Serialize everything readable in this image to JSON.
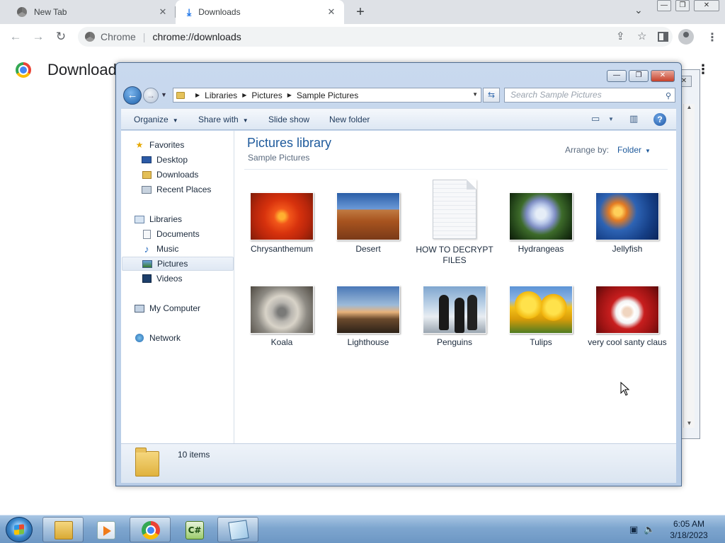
{
  "browser": {
    "tabs": [
      {
        "label": "New Tab",
        "close": "✕"
      },
      {
        "label": "Downloads",
        "close": "✕"
      }
    ],
    "new_tab": "+",
    "tab_search": "⌄",
    "window_controls": {
      "minimize": "—",
      "restore": "❐",
      "close": "✕"
    },
    "omnibox": {
      "site": "Chrome",
      "separator": "|",
      "url": "chrome://downloads"
    },
    "page_title": "Download",
    "icons": [
      "back-icon",
      "forward-icon",
      "reload-icon",
      "share-icon",
      "star-icon",
      "side-panel-icon",
      "profile-icon",
      "kebab-menu-icon"
    ]
  },
  "explorer": {
    "window_controls": {
      "minimize": "—",
      "maximize": "❐",
      "close": "✕"
    },
    "breadcrumb": [
      "Libraries",
      "Sample Pictures"
    ],
    "breadcrumb_mid": "Pictures",
    "search_placeholder": "Search Sample Pictures",
    "commands": {
      "organize": "Organize",
      "share": "Share with",
      "slideshow": "Slide show",
      "new_folder": "New folder"
    },
    "nav": {
      "favorites": "Favorites",
      "desktop": "Desktop",
      "downloads": "Downloads",
      "recent": "Recent Places",
      "libraries": "Libraries",
      "documents": "Documents",
      "music": "Music",
      "pictures": "Pictures",
      "videos": "Videos",
      "computer": "My Computer",
      "network": "Network"
    },
    "library_title": "Pictures library",
    "library_subtitle": "Sample Pictures",
    "arrange_label": "Arrange by:",
    "arrange_value": "Folder",
    "files": [
      {
        "name": "Chrysanthemum"
      },
      {
        "name": "Desert"
      },
      {
        "name": "HOW TO DECRYPT FILES"
      },
      {
        "name": "Hydrangeas"
      },
      {
        "name": "Jellyfish"
      },
      {
        "name": "Koala"
      },
      {
        "name": "Lighthouse"
      },
      {
        "name": "Penguins"
      },
      {
        "name": "Tulips"
      },
      {
        "name": "very cool santy claus"
      }
    ],
    "status": "10 items"
  },
  "taskbar": {
    "apps": [
      "windows-explorer",
      "media-player",
      "chrome",
      "csharp-app",
      "notepad"
    ],
    "clock_time": "6:05 AM",
    "clock_date": "3/18/2023"
  },
  "colors": {
    "explorer_frame": "#c9d9ee",
    "link_blue": "#1e5a9c",
    "taskbar": "#7ea6cf"
  }
}
